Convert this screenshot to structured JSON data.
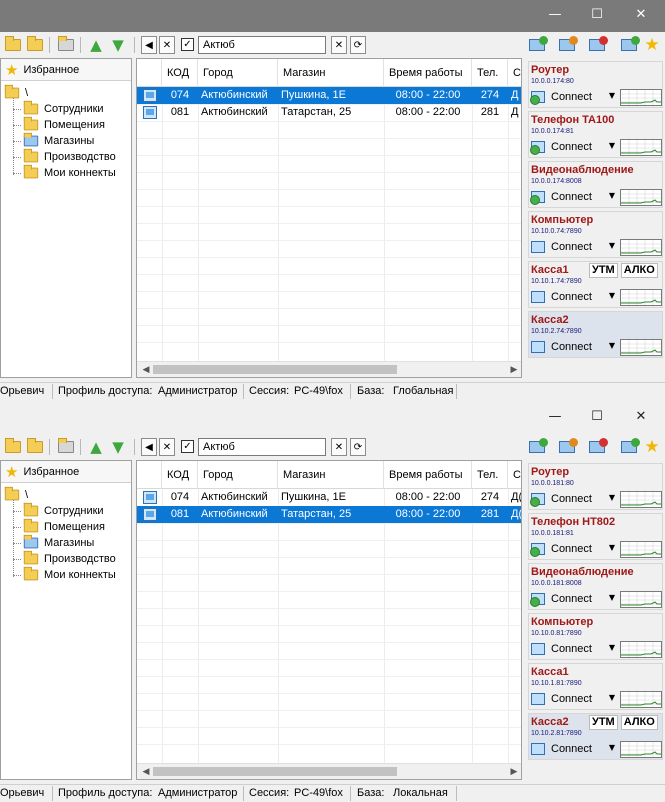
{
  "windows": [
    {
      "id": "a",
      "search_value": "Актюб",
      "favorites_label": "Избранное",
      "tree": {
        "root": "\\",
        "items": [
          "Сотрудники",
          "Помещения",
          "Магазины",
          "Производство",
          "Мои коннекты"
        ]
      },
      "columns": [
        "КОД",
        "Город",
        "Магазин",
        "Время работы",
        "Тел.",
        "С"
      ],
      "rows": [
        {
          "code": "074",
          "city": "Актюбинский",
          "store": "Пушкина, 1Е",
          "hours": "08:00 - 22:00",
          "tel": "274",
          "extra": "Д",
          "selected": true
        },
        {
          "code": "081",
          "city": "Актюбинский",
          "store": "Татарстан, 25",
          "hours": "08:00 - 22:00",
          "tel": "281",
          "extra": "Д",
          "selected": false
        }
      ],
      "panels": [
        {
          "title": "Роутер",
          "ip": "10.0.0.174:80",
          "conn": "Connect",
          "net": true,
          "tags": []
        },
        {
          "title": "Телефон TA100",
          "ip": "10.0.0.174:81",
          "conn": "Connect",
          "net": true,
          "tags": []
        },
        {
          "title": "Видеонаблюдение",
          "ip": "10.0.0.174:8008",
          "conn": "Connect",
          "net": true,
          "tags": []
        },
        {
          "title": "Компьютер",
          "ip": "10.10.0.74:7890",
          "conn": "Connect",
          "net": false,
          "tags": []
        },
        {
          "title": "Касса1",
          "ip": "10.10.1.74:7890",
          "conn": "Connect",
          "net": false,
          "tags": [
            "УТМ",
            "АЛКО"
          ]
        },
        {
          "title": "Касса2",
          "ip": "10.10.2.74:7890",
          "conn": "Connect",
          "net": false,
          "tags": [],
          "highlight": true
        }
      ],
      "status": {
        "user": "Орьевич",
        "profile_label": "Профиль доступа:",
        "profile_value": "Администратор",
        "session_label": "Сессия:",
        "session_value": "PC-49\\fox",
        "base_label": "База:",
        "base_value": "Глобальная"
      }
    },
    {
      "id": "b",
      "search_value": "Актюб",
      "favorites_label": "Избранное",
      "tree": {
        "root": "\\",
        "items": [
          "Сотрудники",
          "Помещения",
          "Магазины",
          "Производство",
          "Мои коннекты"
        ]
      },
      "columns": [
        "КОД",
        "Город",
        "Магазин",
        "Время работы",
        "Тел.",
        "С"
      ],
      "rows": [
        {
          "code": "074",
          "city": "Актюбинский",
          "store": "Пушкина, 1Е",
          "hours": "08:00 - 22:00",
          "tel": "274",
          "extra": "Д(",
          "selected": false
        },
        {
          "code": "081",
          "city": "Актюбинский",
          "store": "Татарстан, 25",
          "hours": "08:00 - 22:00",
          "tel": "281",
          "extra": "Д(",
          "selected": true
        }
      ],
      "panels": [
        {
          "title": "Роутер",
          "ip": "10.0.0.181:80",
          "conn": "Connect",
          "net": true,
          "tags": []
        },
        {
          "title": "Телефон HT802",
          "ip": "10.0.0.181:81",
          "conn": "Connect",
          "net": true,
          "tags": []
        },
        {
          "title": "Видеонаблюдение",
          "ip": "10.0.0.181:8008",
          "conn": "Connect",
          "net": true,
          "tags": []
        },
        {
          "title": "Компьютер",
          "ip": "10.10.0.81:7890",
          "conn": "Connect",
          "net": false,
          "tags": []
        },
        {
          "title": "Касса1",
          "ip": "10.10.1.81:7890",
          "conn": "Connect",
          "net": false,
          "tags": []
        },
        {
          "title": "Касса2",
          "ip": "10.10.2.81:7890",
          "conn": "Connect",
          "net": false,
          "tags": [
            "УТМ",
            "АЛКО"
          ],
          "highlight": true
        }
      ],
      "status": {
        "user": "Орьевич",
        "profile_label": "Профиль доступа:",
        "profile_value": "Администратор",
        "session_label": "Сессия:",
        "session_value": "PC-49\\fox",
        "base_label": "База:",
        "base_value": "Локальная"
      }
    }
  ],
  "title_buttons": {
    "minimize": "—",
    "maximize": "☐",
    "close": "✕"
  },
  "icons": {
    "folder_open": "folder-open-icon",
    "arrow_up": "▲",
    "arrow_down": "▼",
    "nav_left": "◀",
    "clear": "✕",
    "check": "✓",
    "clear_search": "✕",
    "refresh": "⟳",
    "star": "★",
    "dropdown": "▼",
    "scroll_left": "◀",
    "scroll_right": "▶"
  },
  "colors": {
    "selection": "#0b78d6",
    "panel_title": "#a01818",
    "ip_text": "#16167a",
    "accent_green": "#3ea83e"
  }
}
